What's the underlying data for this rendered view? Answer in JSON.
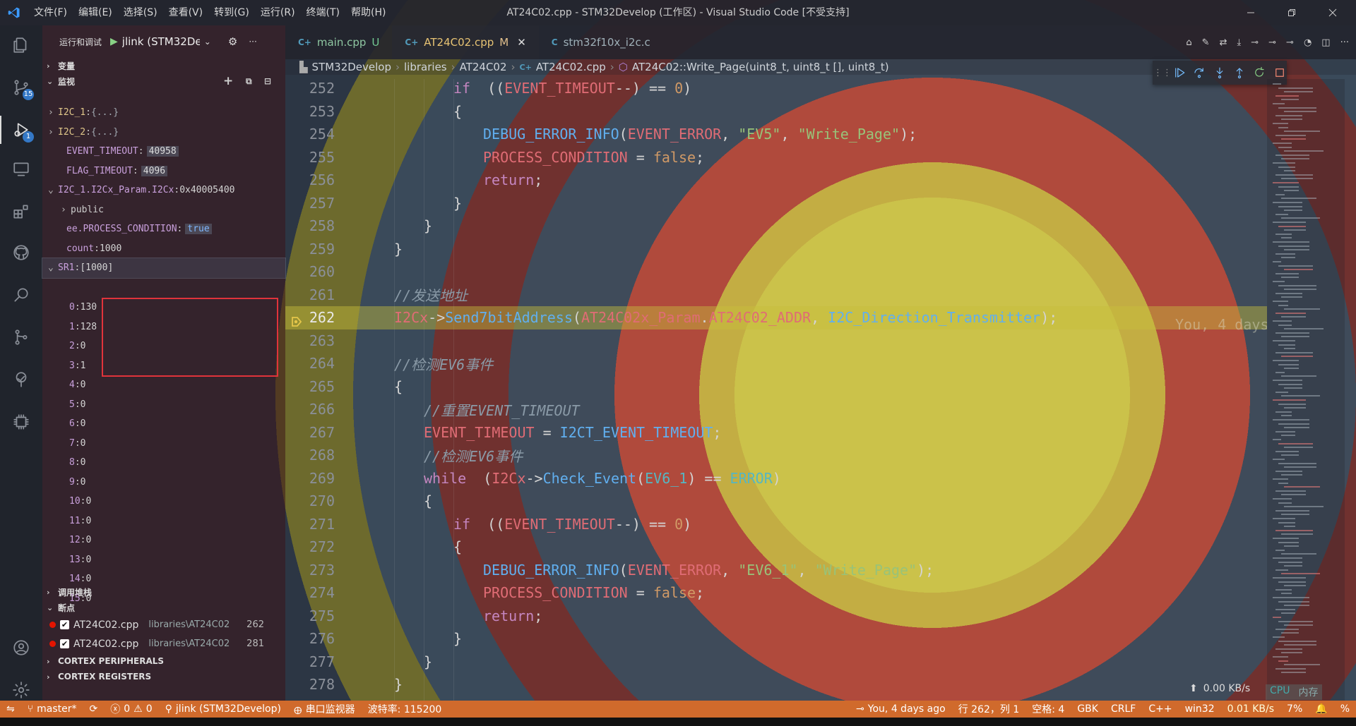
{
  "title_bar": {
    "menus": [
      "文件(F)",
      "编辑(E)",
      "选择(S)",
      "查看(V)",
      "转到(G)",
      "运行(R)",
      "终端(T)",
      "帮助(H)"
    ],
    "title": "AT24C02.cpp - STM32Develop (工作区) - Visual Studio Code [不受支持]"
  },
  "activity": {
    "scm_badge": "15",
    "debug_badge": "1"
  },
  "sidebar": {
    "run_label": "运行和调试",
    "config": "jlink (STM32Develop)",
    "sections": {
      "variables": "变量",
      "watch": "监视",
      "callstack": "调用堆栈",
      "breakpoints": "断点",
      "cortex_peripherals": "CORTEX PERIPHERALS",
      "cortex_registers": "CORTEX REGISTERS"
    },
    "watch": [
      {
        "chev": "›",
        "name": "I2C_1",
        "value": "{...}",
        "style": "dim"
      },
      {
        "chev": "›",
        "name": "I2C_2",
        "value": "{...}",
        "style": "dim"
      },
      {
        "chev": "",
        "name": "EVENT_TIMEOUT",
        "value": "40958",
        "style": "chip"
      },
      {
        "chev": "",
        "name": "FLAG_TIMEOUT",
        "value": "4096",
        "style": "chip"
      },
      {
        "chev": "⌄",
        "name": "I2C_1.I2Cx_Param.I2Cx",
        "value": "0x40005400",
        "style": "plain"
      },
      {
        "chev": "›",
        "name": "public",
        "value": "",
        "style": "child"
      },
      {
        "chev": "",
        "name": "ee.PROCESS_CONDITION",
        "value": "true",
        "style": "bool"
      },
      {
        "chev": "",
        "name": "count",
        "value": "1000",
        "style": "plain"
      },
      {
        "chev": "⌄",
        "name": "SR1",
        "value": "[1000]",
        "style": "sel"
      }
    ],
    "sr1_items": [
      [
        "0",
        "130"
      ],
      [
        "1",
        "128"
      ],
      [
        "2",
        "0"
      ],
      [
        "3",
        "1"
      ],
      [
        "4",
        "0"
      ],
      [
        "5",
        "0"
      ],
      [
        "6",
        "0"
      ],
      [
        "7",
        "0"
      ],
      [
        "8",
        "0"
      ],
      [
        "9",
        "0"
      ],
      [
        "10",
        "0"
      ],
      [
        "11",
        "0"
      ],
      [
        "12",
        "0"
      ],
      [
        "13",
        "0"
      ],
      [
        "14",
        "0"
      ],
      [
        "15",
        "0"
      ]
    ],
    "breakpoints": [
      {
        "file": "AT24C02.cpp",
        "path": "libraries\\AT24C02",
        "line": "262"
      },
      {
        "file": "AT24C02.cpp",
        "path": "libraries\\AT24C02",
        "line": "281"
      }
    ]
  },
  "tabs": [
    {
      "name": "main.cpp",
      "status": "U",
      "active": false
    },
    {
      "name": "AT24C02.cpp",
      "status": "M",
      "active": true
    },
    {
      "name": "stm32f10x_i2c.c",
      "status": "",
      "active": false
    }
  ],
  "breadcrumb": [
    "STM32Develop",
    "libraries",
    "AT24C02",
    "AT24C02.cpp",
    "AT24C02::Write_Page(uint8_t, uint8_t [], uint8_t)"
  ],
  "editor": {
    "current_line": "262",
    "blame": "You, 4 days ago",
    "lines": [
      {
        "n": "252",
        "i": 2,
        "t": [
          [
            "kw",
            "if"
          ],
          [
            "",
            "  (("
          ],
          [
            "mac",
            "EVENT_TIMEOUT"
          ],
          [
            "",
            "--) == "
          ],
          [
            "num",
            "0"
          ],
          [
            "",
            ")"
          ]
        ]
      },
      {
        "n": "253",
        "i": 2,
        "t": [
          [
            "",
            "{"
          ]
        ]
      },
      {
        "n": "254",
        "i": 3,
        "t": [
          [
            "fn",
            "DEBUG_ERROR_INFO"
          ],
          [
            "",
            "("
          ],
          [
            "mac",
            "EVENT_ERROR"
          ],
          [
            "",
            ", "
          ],
          [
            "str",
            "\"EV5\""
          ],
          [
            "",
            ", "
          ],
          [
            "str",
            "\"Write_Page\""
          ],
          [
            "",
            ");"
          ]
        ]
      },
      {
        "n": "255",
        "i": 3,
        "t": [
          [
            "mac",
            "PROCESS_CONDITION"
          ],
          [
            "",
            " = "
          ],
          [
            "num",
            "false"
          ],
          [
            "",
            ";"
          ]
        ]
      },
      {
        "n": "256",
        "i": 3,
        "t": [
          [
            "kw",
            "return"
          ],
          [
            "",
            ";"
          ]
        ]
      },
      {
        "n": "257",
        "i": 2,
        "t": [
          [
            "",
            "}"
          ]
        ]
      },
      {
        "n": "258",
        "i": 1,
        "t": [
          [
            "",
            "}"
          ]
        ]
      },
      {
        "n": "259",
        "i": 0,
        "t": [
          [
            "",
            "}"
          ]
        ]
      },
      {
        "n": "260",
        "i": 0,
        "t": []
      },
      {
        "n": "261",
        "i": 0,
        "t": [
          [
            "cmt",
            "//发送地址"
          ]
        ]
      },
      {
        "n": "262",
        "i": 0,
        "t": [
          [
            "mac",
            "I2Cx"
          ],
          [
            "",
            "->"
          ],
          [
            "fn",
            "Send7bitAddress"
          ],
          [
            "",
            "("
          ],
          [
            "mac",
            "AT24C02x_Param"
          ],
          [
            "",
            "."
          ],
          [
            "mac",
            "AT24C02_ADDR"
          ],
          [
            "",
            ", "
          ],
          [
            "fn",
            "I2C_Direction_Transmitter"
          ],
          [
            "",
            ");"
          ]
        ]
      },
      {
        "n": "263",
        "i": 0,
        "t": []
      },
      {
        "n": "264",
        "i": 0,
        "t": [
          [
            "cmt",
            "//检测EV6事件"
          ]
        ]
      },
      {
        "n": "265",
        "i": 0,
        "t": [
          [
            "",
            "{"
          ]
        ]
      },
      {
        "n": "266",
        "i": 1,
        "t": [
          [
            "cmt",
            "//重置EVENT_TIMEOUT"
          ]
        ]
      },
      {
        "n": "267",
        "i": 1,
        "t": [
          [
            "mac",
            "EVENT_TIMEOUT"
          ],
          [
            "",
            " = "
          ],
          [
            "fn",
            "I2CT_EVENT_TIMEOUT"
          ],
          [
            "",
            ";"
          ]
        ]
      },
      {
        "n": "268",
        "i": 1,
        "t": [
          [
            "cmt",
            "//检测EV6事件"
          ]
        ]
      },
      {
        "n": "269",
        "i": 1,
        "t": [
          [
            "kw",
            "while"
          ],
          [
            "",
            "  ("
          ],
          [
            "mac",
            "I2Cx"
          ],
          [
            "",
            "->"
          ],
          [
            "fn",
            "Check_Event"
          ],
          [
            "",
            "("
          ],
          [
            "typ",
            "EV6_1"
          ],
          [
            "",
            ") == "
          ],
          [
            "typ",
            "ERROR"
          ],
          [
            "",
            ")"
          ]
        ]
      },
      {
        "n": "270",
        "i": 1,
        "t": [
          [
            "",
            "{"
          ]
        ]
      },
      {
        "n": "271",
        "i": 2,
        "t": [
          [
            "kw",
            "if"
          ],
          [
            "",
            "  (("
          ],
          [
            "mac",
            "EVENT_TIMEOUT"
          ],
          [
            "",
            "--) == "
          ],
          [
            "num",
            "0"
          ],
          [
            "",
            ")"
          ]
        ]
      },
      {
        "n": "272",
        "i": 2,
        "t": [
          [
            "",
            "{"
          ]
        ]
      },
      {
        "n": "273",
        "i": 3,
        "t": [
          [
            "fn",
            "DEBUG_ERROR_INFO"
          ],
          [
            "",
            "("
          ],
          [
            "mac",
            "EVENT_ERROR"
          ],
          [
            "",
            ", "
          ],
          [
            "str",
            "\"EV6_1\""
          ],
          [
            "",
            ", "
          ],
          [
            "str",
            "\"Write_Page\""
          ],
          [
            "",
            ");"
          ]
        ]
      },
      {
        "n": "274",
        "i": 3,
        "t": [
          [
            "mac",
            "PROCESS_CONDITION"
          ],
          [
            "",
            " = "
          ],
          [
            "num",
            "false"
          ],
          [
            "",
            ";"
          ]
        ]
      },
      {
        "n": "275",
        "i": 3,
        "t": [
          [
            "kw",
            "return"
          ],
          [
            "",
            ";"
          ]
        ]
      },
      {
        "n": "276",
        "i": 2,
        "t": [
          [
            "",
            "}"
          ]
        ]
      },
      {
        "n": "277",
        "i": 1,
        "t": [
          [
            "",
            "}"
          ]
        ]
      },
      {
        "n": "278",
        "i": 0,
        "t": [
          [
            "",
            "}"
          ]
        ]
      }
    ]
  },
  "status": {
    "branch": "master*",
    "errors": "0",
    "warnings": "0",
    "debug_config": "jlink (STM32Develop)",
    "serial": "串口监视器",
    "baud": "波特率: 115200",
    "blame": "You, 4 days ago",
    "cursor": "行 262，列 1",
    "spaces": "空格: 4",
    "encoding": "GBK",
    "eol": "CRLF",
    "language": "C++",
    "platform": "win32",
    "percent": "%"
  },
  "overlay": {
    "net_up": "0.00 KB/s",
    "net_down": "0.01 KB/s",
    "cpu": "CPU",
    "mem": "内存",
    "cpu_val": "7%"
  },
  "colors": {
    "status": "#d06a2c",
    "current_line": "#c8be3c",
    "red_box": "#e0333b",
    "badge": "#3478c6"
  }
}
